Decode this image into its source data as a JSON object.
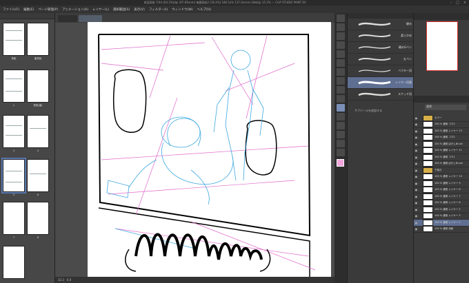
{
  "window": {
    "title": "紙面表紙 7/44 (64.3%)dpi (97.8%mm) 無題表紙2 [36.4%] 180.5x% 137.0mm/s [Web]p 15.3% — CLIP STUDIO PAINT EX",
    "controls": [
      "–",
      "□",
      "×"
    ]
  },
  "menu": [
    "ファイル(F)",
    "編集(E)",
    "ページ管理(P)",
    "アニメーション(A)",
    "レイヤー(L)",
    "選択範囲(S)",
    "表示(V)",
    "フィルター(I)",
    "ウィンドウ(W)",
    "ヘルプ(H)"
  ],
  "pages_panel": {
    "labels": [
      "表紙",
      "裏表紙",
      "1",
      "表紙(裏)",
      "3",
      "4",
      "5",
      "6",
      "7",
      "8"
    ]
  },
  "brushes": [
    {
      "name": "硬め",
      "selected": false
    },
    {
      "name": "柔らかめ",
      "selected": false
    },
    {
      "name": "硬めGペン",
      "selected": false
    },
    {
      "name": "丸ペン",
      "selected": false
    },
    {
      "name": "ベクター用",
      "selected": false
    },
    {
      "name": "レイヤー用墨",
      "selected": true
    },
    {
      "name": "スケッチ用",
      "selected": false
    }
  ],
  "add_tool_label": "サブツールを追加する",
  "layer_panel": {
    "blend": "通常",
    "layers": [
      {
        "name": "カラー",
        "folder": true,
        "selected": false
      },
      {
        "name": "100 % 通常 コマ2",
        "folder": false,
        "selected": false
      },
      {
        "name": "100 % 通常 レイヤー 13",
        "folder": false,
        "selected": false
      },
      {
        "name": "100 % 通常 コマ2",
        "folder": false,
        "selected": false
      },
      {
        "name": "100 % 通常 ぼかしBrush",
        "folder": false,
        "selected": false
      },
      {
        "name": "100 % 通常 レイヤー 11",
        "folder": false,
        "selected": false
      },
      {
        "name": "100 % 通常 コマ1",
        "folder": false,
        "selected": false
      },
      {
        "name": "100 % 通常 ぼかしBrush",
        "folder": false,
        "selected": false
      },
      {
        "name": "下描き",
        "folder": true,
        "selected": false
      },
      {
        "name": "100 % 通常 レイヤー 10",
        "folder": false,
        "selected": false
      },
      {
        "name": "100 % 通常 レイヤー 9",
        "folder": false,
        "selected": false
      },
      {
        "name": "100 % 通常 レイヤー 8",
        "folder": false,
        "selected": false
      },
      {
        "name": "100 % 通常 レイヤー 7",
        "folder": false,
        "selected": false
      },
      {
        "name": "100 % 通常 レイヤー 6",
        "folder": false,
        "selected": false
      },
      {
        "name": "100 % 通常 レイヤー 5",
        "folder": false,
        "selected": false
      },
      {
        "name": "100 % 通常 レイヤー 3",
        "folder": false,
        "selected": false
      },
      {
        "name": "100 % 通常 レイヤー 1",
        "folder": false,
        "selected": true
      },
      {
        "name": "100 % 通常 用紙",
        "folder": false,
        "selected": false
      }
    ]
  },
  "status": {
    "zoom": "33.3",
    "angle": "0.0"
  },
  "colors": {
    "main_color": "#f4a6dc",
    "accent": "#5f6f92"
  }
}
